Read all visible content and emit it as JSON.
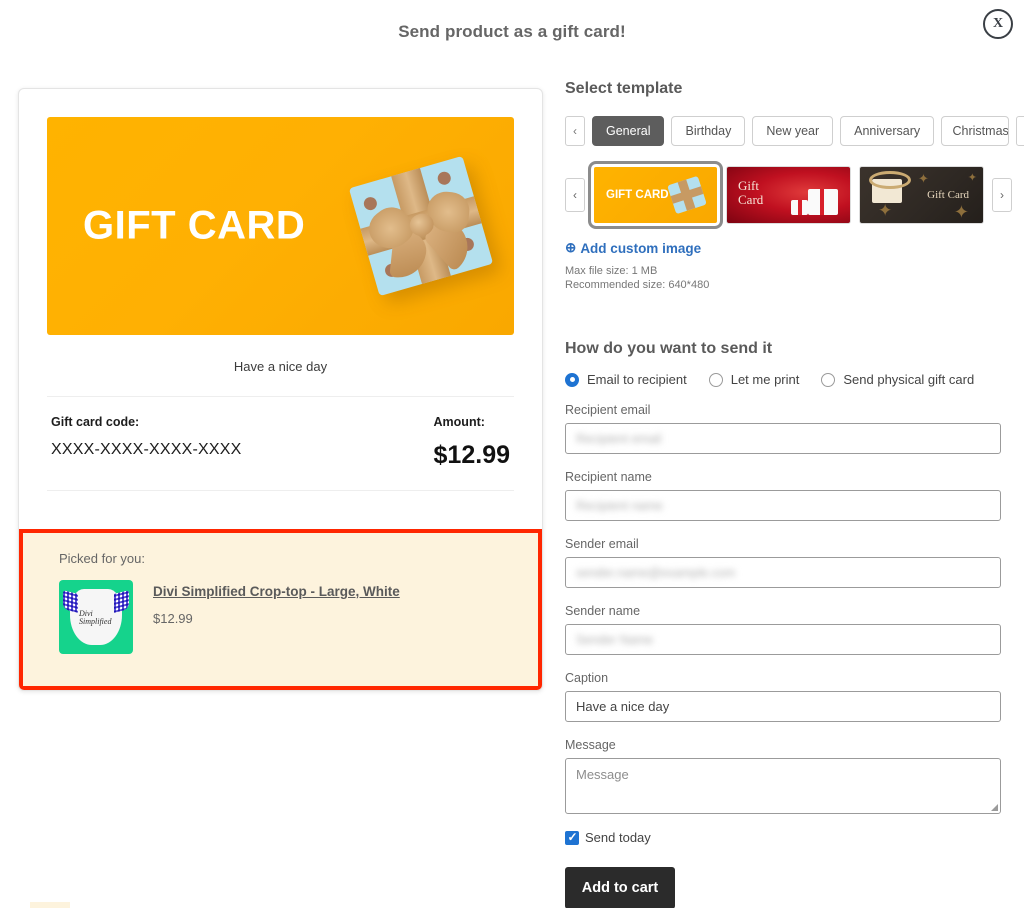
{
  "header": {
    "title": "Send product as a gift card!",
    "close_label": "X"
  },
  "preview": {
    "card_banner_text": "GIFT CARD",
    "caption": "Have a nice day",
    "code_label": "Gift card code:",
    "code_value": "XXXX-XXXX-XXXX-XXXX",
    "amount_label": "Amount:",
    "amount_value": "$12.99",
    "picked_label": "Picked for you:",
    "product_title": "Divi Simplified Crop-top - Large, White",
    "product_price": "$12.99",
    "product_thumb_script": "Divi\nSimplified"
  },
  "templates": {
    "section_title": "Select template",
    "prev_label": "‹",
    "next_label": "›",
    "tabs": [
      {
        "label": "General",
        "active": true
      },
      {
        "label": "Birthday",
        "active": false
      },
      {
        "label": "New year",
        "active": false
      },
      {
        "label": "Anniversary",
        "active": false
      },
      {
        "label": "Christmas",
        "active": false
      }
    ],
    "thumbs": [
      {
        "label": "GIFT CARD",
        "selected": true,
        "style": "yellow"
      },
      {
        "label": "Gift Card",
        "selected": false,
        "style": "red"
      },
      {
        "label": "Gift Card",
        "selected": false,
        "style": "dark"
      }
    ],
    "add_custom_label": "Add custom image",
    "add_custom_icon": "plus-circle-icon",
    "max_file_size": "Max file size: 1 MB",
    "recommended_size": "Recommended size: 640*480"
  },
  "send_method": {
    "title": "How do you want to send it",
    "options": [
      {
        "label": "Email to recipient",
        "selected": true
      },
      {
        "label": "Let me print",
        "selected": false
      },
      {
        "label": "Send physical gift card",
        "selected": false
      }
    ]
  },
  "form": {
    "recipient_email": {
      "label": "Recipient email",
      "value": "Recipient email",
      "redacted": true
    },
    "recipient_name": {
      "label": "Recipient name",
      "value": "Recipient name",
      "redacted": true
    },
    "sender_email": {
      "label": "Sender email",
      "value": "sender.name@example.com",
      "redacted": true
    },
    "sender_name": {
      "label": "Sender name",
      "value": "Sender Name",
      "redacted": true
    },
    "caption": {
      "label": "Caption",
      "value": "Have a nice day"
    },
    "message": {
      "label": "Message",
      "placeholder": "Message",
      "value": ""
    },
    "send_today": {
      "label": "Send today",
      "checked": true
    },
    "submit_label": "Add to cart"
  },
  "colors": {
    "accent_blue": "#1e73d2",
    "link_blue": "#2f6fbd",
    "card_yellow": "#ffb300",
    "highlight_red": "#ff2600",
    "picked_bg": "#fdf3dd",
    "active_tab": "#5d5d5d",
    "button_dark": "#2b2b2b",
    "thumb_green": "#15d38c"
  }
}
